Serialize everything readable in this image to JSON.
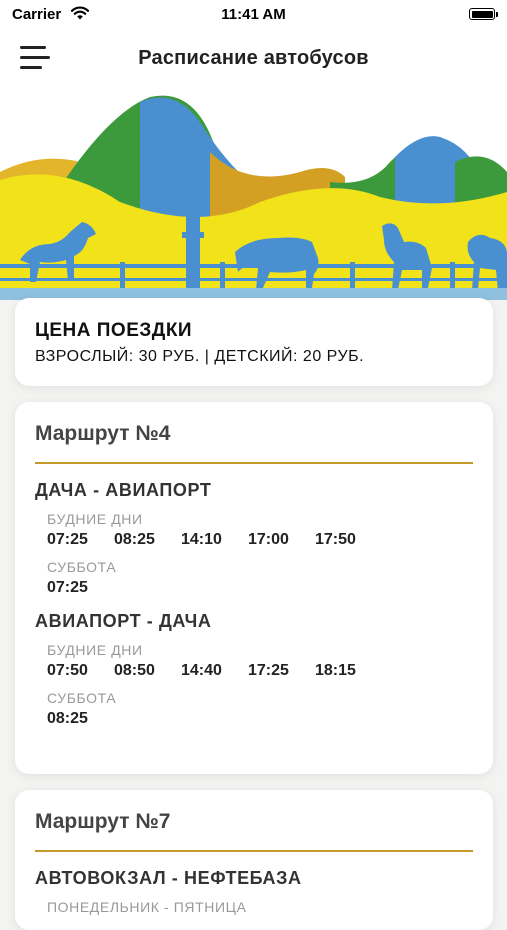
{
  "status_bar": {
    "carrier": "Carrier",
    "time": "11:41 AM"
  },
  "nav": {
    "title": "Расписание автобусов"
  },
  "price": {
    "heading": "ЦЕНА ПОЕЗДКИ",
    "text": "ВЗРОСЛЫЙ: 30 РУБ. | ДЕТСКИЙ: 20 РУБ."
  },
  "routes": [
    {
      "title": "Маршрут №4",
      "directions": [
        {
          "name": "ДАЧА - АВИАПОРТ",
          "weekday_label": "БУДНИЕ ДНИ",
          "weekday_times": [
            "07:25",
            "08:25",
            "14:10",
            "17:00",
            "17:50"
          ],
          "saturday_label": "СУББОТА",
          "saturday_times": [
            "07:25"
          ]
        },
        {
          "name": "АВИАПОРТ - ДАЧА",
          "weekday_label": "БУДНИЕ ДНИ",
          "weekday_times": [
            "07:50",
            "08:50",
            "14:40",
            "17:25",
            "18:15"
          ],
          "saturday_label": "СУББОТА",
          "saturday_times": [
            "08:25"
          ]
        }
      ]
    },
    {
      "title": "Маршрут №7",
      "directions": [
        {
          "name": "АВТОВОКЗАЛ - НЕФТЕБАЗА",
          "weekday_label": "ПОНЕДЕЛЬНИК - ПЯТНИЦА"
        }
      ]
    }
  ],
  "colors": {
    "accent": "#c39a2a",
    "banner_yellow": "#f2e21a",
    "banner_blue": "#4a90d0",
    "banner_green": "#3c9a3c"
  },
  "icons": {
    "menu": "hamburger-menu-icon",
    "wifi": "wifi-icon",
    "battery": "battery-icon"
  }
}
